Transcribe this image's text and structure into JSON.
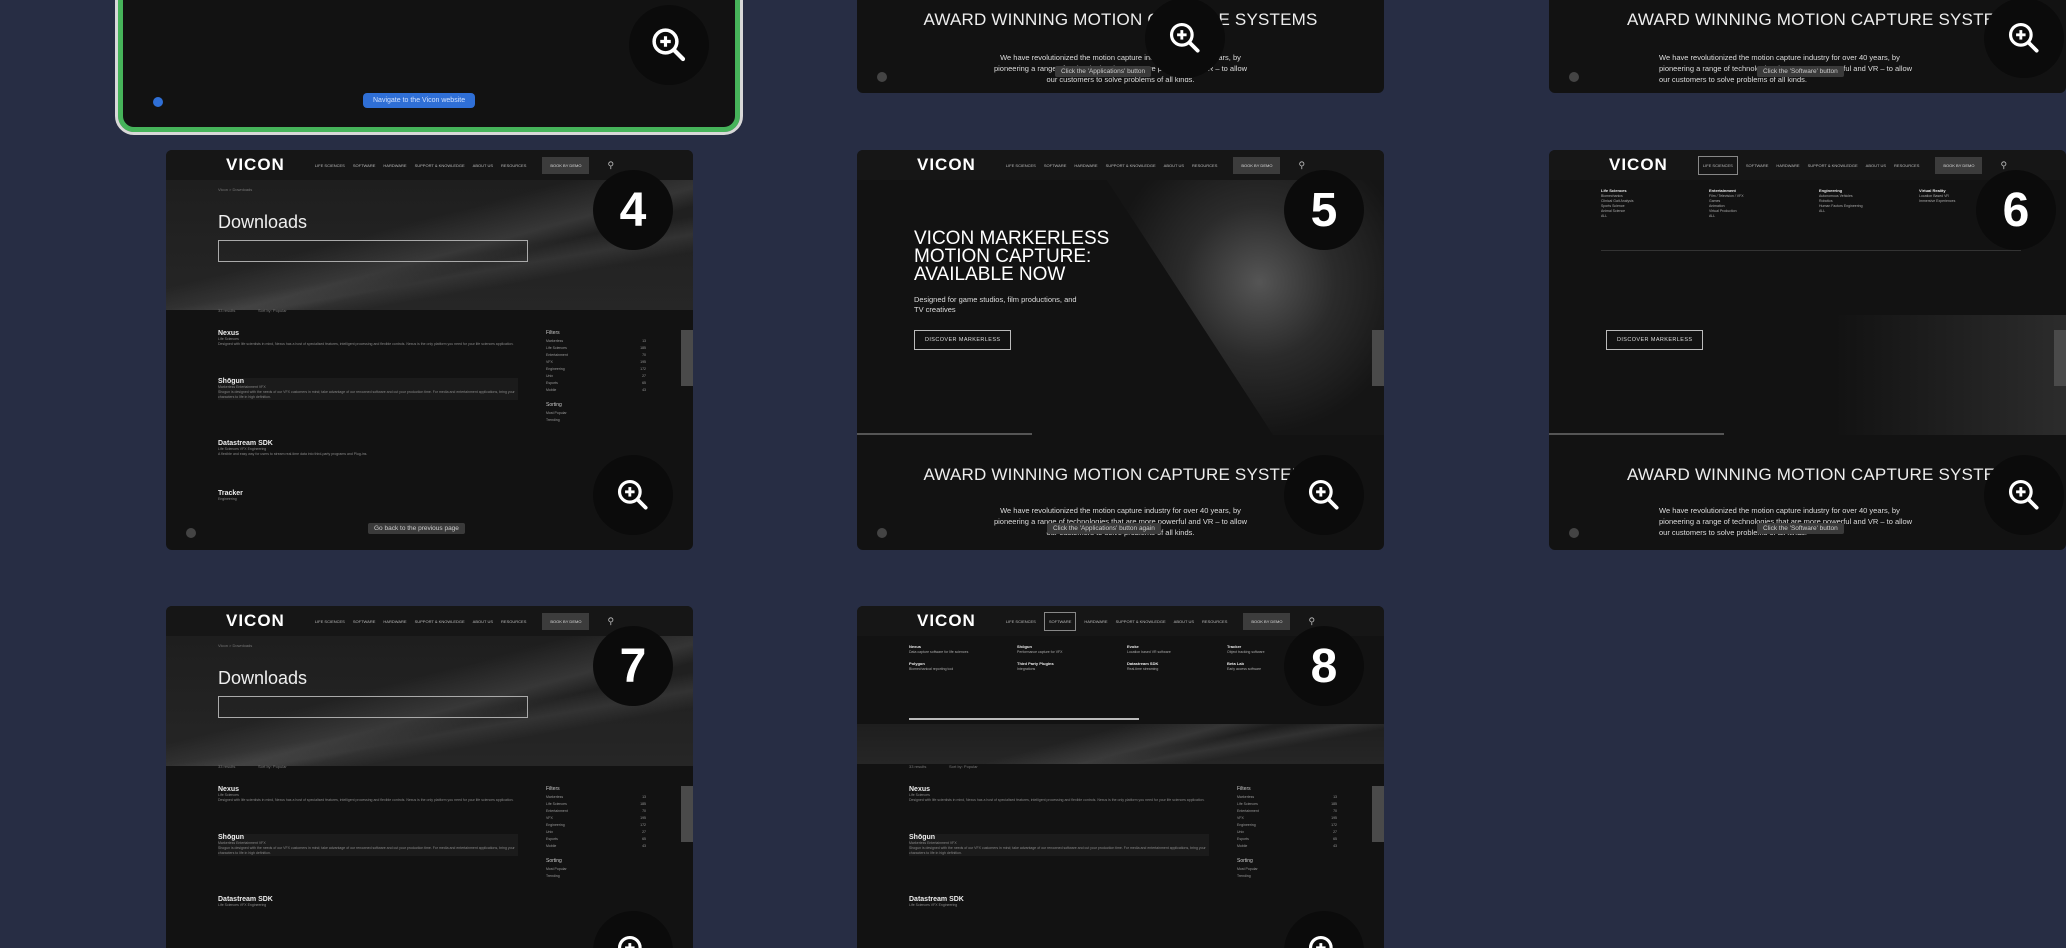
{
  "brand": {
    "logo": "VICON",
    "selected_border": "#46b35a",
    "background": "#272d44"
  },
  "nav": {
    "items": [
      "Life Sciences",
      "Software",
      "Hardware",
      "Support & Knowledge",
      "About Us",
      "Resources"
    ],
    "cta": "Book By Demo",
    "search_icon": "search-icon"
  },
  "downloads": {
    "breadcrumb": "Vicon > Downloads",
    "title": "Downloads",
    "results": "33 results",
    "sort": "Sort by: Popular",
    "products": [
      {
        "name": "Nexus",
        "tags": "Life Sciences",
        "desc": "Designed with life scientists in mind, Nexus has a host of specialised features, intelligent processing and flexible controls. Nexus is the only platform you need for your life sciences application.",
        "action": "Learn More",
        "version": "Sort/Tags"
      },
      {
        "name": "Shōgun",
        "tags": "Markerless  Entertainment  VFX",
        "desc": "Shogun is designed with the needs of our VFX customers in mind; take advantage of our renowned software and cut your production time. For media and entertainment applications, bring your characters to life in high definition.",
        "action": "Learn More",
        "version": "Sort/Tags"
      },
      {
        "name": "Datastream SDK",
        "tags": "Life Sciences  VFX  Engineering",
        "desc": "A flexible and easy way for users to stream real-time data into third-party programs and Plug-ins.",
        "action": "Learn More",
        "version": "Sort/Tags"
      },
      {
        "name": "Tracker",
        "tags": "Engineering",
        "desc": "Whether tracking objects, rigid bodies or drones, Tracker gives you a world of possibilities to capture motion data.",
        "action": "Learn More",
        "version": "Sort/Tags"
      }
    ],
    "filters_title": "Filters",
    "filters": [
      {
        "label": "Markerless",
        "count": "13"
      },
      {
        "label": "Life Sciences",
        "count": "185"
      },
      {
        "label": "Entertainment",
        "count": "70"
      },
      {
        "label": "VFX",
        "count": "195"
      },
      {
        "label": "Engineering",
        "count": "172"
      },
      {
        "label": "Unix",
        "count": "27"
      },
      {
        "label": "Esports",
        "count": "65"
      },
      {
        "label": "Mobile",
        "count": "43"
      }
    ],
    "sorting_title": "Sorting",
    "sorting": [
      "Most Popular",
      "Trending",
      "Latest First",
      "A-Z"
    ],
    "side_tab": "Get in touch"
  },
  "award": {
    "title": "AWARD WINNING MOTION CAPTURE SYSTEMS",
    "text": "We have revolutionized the motion capture industry for over 40 years, by pioneering a range of technologies that are more powerful and VR – to allow our customers to solve problems of all kinds.",
    "text_line1": "We have revolutionized the motion capture industry for over 40 years, by",
    "text_line2": "pioneering a range of technologies that are more powerful and VR – to allow",
    "text_line3": "our customers to solve problems of all kinds."
  },
  "markerless": {
    "title_line1": "VICON MARKERLESS",
    "title_line2": "MOTION CAPTURE:",
    "title_line3": "AVAILABLE NOW",
    "sub_line1": "Designed for game studios, film productions, and",
    "sub_line2": "TV creatives",
    "button": "Discover Markerless"
  },
  "cards": [
    {
      "number": "",
      "tooltip": "",
      "button": "Navigate to the Vicon website"
    },
    {
      "number": "",
      "tooltip": "Click the 'Applications' button"
    },
    {
      "number": "",
      "tooltip": "Click the 'Software' button"
    },
    {
      "number": "4",
      "tooltip": "Go back to the previous page"
    },
    {
      "number": "5",
      "tooltip": "Click the 'Applications' button again"
    },
    {
      "number": "6",
      "tooltip": "Click the 'Software' button"
    },
    {
      "number": "7",
      "tooltip": ""
    },
    {
      "number": "8",
      "tooltip": ""
    }
  ],
  "megamenu_apps": [
    {
      "head": "Life Sciences",
      "lines": [
        "Biomechanics",
        "Clinical Gait Analysis",
        "Sports Science",
        "Animal Science",
        "ALL"
      ]
    },
    {
      "head": "Entertainment",
      "lines": [
        "Film / Television / VFX",
        "Games",
        "Animation",
        "Virtual Production",
        "ALL"
      ]
    },
    {
      "head": "Engineering",
      "lines": [
        "Autonomous Vehicles",
        "Robotics",
        "Human Factors Engineering",
        "ALL"
      ]
    },
    {
      "head": "Virtual Reality",
      "lines": [
        "Location Based VR",
        "Immersive Experiences"
      ]
    }
  ],
  "megamenu_soft": [
    {
      "head": "Nexus",
      "lines": [
        "Data capture software for life sciences"
      ]
    },
    {
      "head": "Shōgun",
      "lines": [
        "Performance capture for VFX"
      ]
    },
    {
      "head": "Evoke",
      "lines": [
        "Location based VR software"
      ]
    },
    {
      "head": "Tracker",
      "lines": [
        "Object tracking software"
      ]
    },
    {
      "head": "Polygon",
      "lines": [
        "Biomechanical reporting tool"
      ]
    },
    {
      "head": "Third Party Plugins",
      "lines": [
        "Integrations"
      ]
    },
    {
      "head": "Datastream SDK",
      "lines": [
        "Real-time streaming"
      ]
    },
    {
      "head": "Beta Lab",
      "lines": [
        "Early access software"
      ]
    }
  ]
}
